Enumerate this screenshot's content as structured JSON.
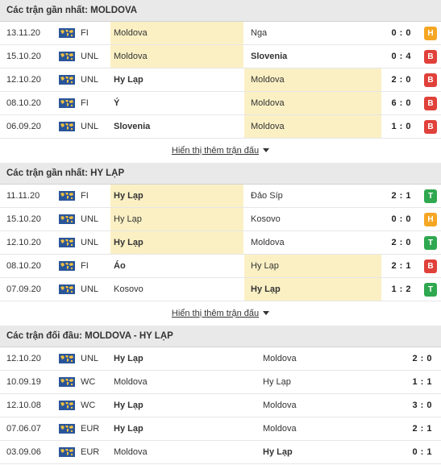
{
  "sections": [
    {
      "title": "Các trận gần nhất: MOLDOVA",
      "rows": [
        {
          "date": "13.11.20",
          "comp": "FI",
          "home": "Moldova",
          "away": "Nga",
          "score": "0 : 0",
          "result": "H"
        },
        {
          "date": "15.10.20",
          "comp": "UNL",
          "home": "Moldova",
          "away": "Slovenia",
          "score": "0 : 4",
          "result": "B"
        },
        {
          "date": "12.10.20",
          "comp": "UNL",
          "home": "Hy Lạp",
          "away": "Moldova",
          "score": "2 : 0",
          "result": "B"
        },
        {
          "date": "08.10.20",
          "comp": "FI",
          "home": "Ý",
          "away": "Moldova",
          "score": "6 : 0",
          "result": "B"
        },
        {
          "date": "06.09.20",
          "comp": "UNL",
          "home": "Slovenia",
          "away": "Moldova",
          "score": "1 : 0",
          "result": "B"
        }
      ],
      "more_label": "Hiển thị thêm trận đấu"
    },
    {
      "title": "Các trận gần nhất: HY LẠP",
      "rows": [
        {
          "date": "11.11.20",
          "comp": "FI",
          "home": "Hy Lạp",
          "away": "Đảo Síp",
          "score": "2 : 1",
          "result": "T"
        },
        {
          "date": "15.10.20",
          "comp": "UNL",
          "home": "Hy Lạp",
          "away": "Kosovo",
          "score": "0 : 0",
          "result": "H"
        },
        {
          "date": "12.10.20",
          "comp": "UNL",
          "home": "Hy Lạp",
          "away": "Moldova",
          "score": "2 : 0",
          "result": "T"
        },
        {
          "date": "08.10.20",
          "comp": "FI",
          "home": "Áo",
          "away": "Hy Lạp",
          "score": "2 : 1",
          "result": "B"
        },
        {
          "date": "07.09.20",
          "comp": "UNL",
          "home": "Kosovo",
          "away": "Hy Lạp",
          "score": "1 : 2",
          "result": "T"
        }
      ],
      "more_label": "Hiển thị thêm trận đấu"
    },
    {
      "title": "Các trận đối đầu: MOLDOVA - HY LẠP",
      "rows": [
        {
          "date": "12.10.20",
          "comp": "UNL",
          "home": "Hy Lạp",
          "away": "Moldova",
          "score": "2 : 0"
        },
        {
          "date": "10.09.19",
          "comp": "WC",
          "home": "Moldova",
          "away": "Hy Lạp",
          "score": "1 : 1"
        },
        {
          "date": "12.10.08",
          "comp": "WC",
          "home": "Hy Lạp",
          "away": "Moldova",
          "score": "3 : 0"
        },
        {
          "date": "07.06.07",
          "comp": "EUR",
          "home": "Hy Lạp",
          "away": "Moldova",
          "score": "2 : 1"
        },
        {
          "date": "03.09.06",
          "comp": "EUR",
          "home": "Moldova",
          "away": "Hy Lạp",
          "score": "0 : 1"
        }
      ]
    }
  ],
  "colors": {
    "header_bg": "#e9e9e9",
    "highlight_bg": "#fbf0c4",
    "result_H": "#f5a623",
    "result_B": "#e0413a",
    "result_T": "#2fa84f",
    "competition_icon": "#2a5599"
  },
  "icons": {
    "competition": "world-map-icon",
    "more": "caret-down-icon"
  }
}
